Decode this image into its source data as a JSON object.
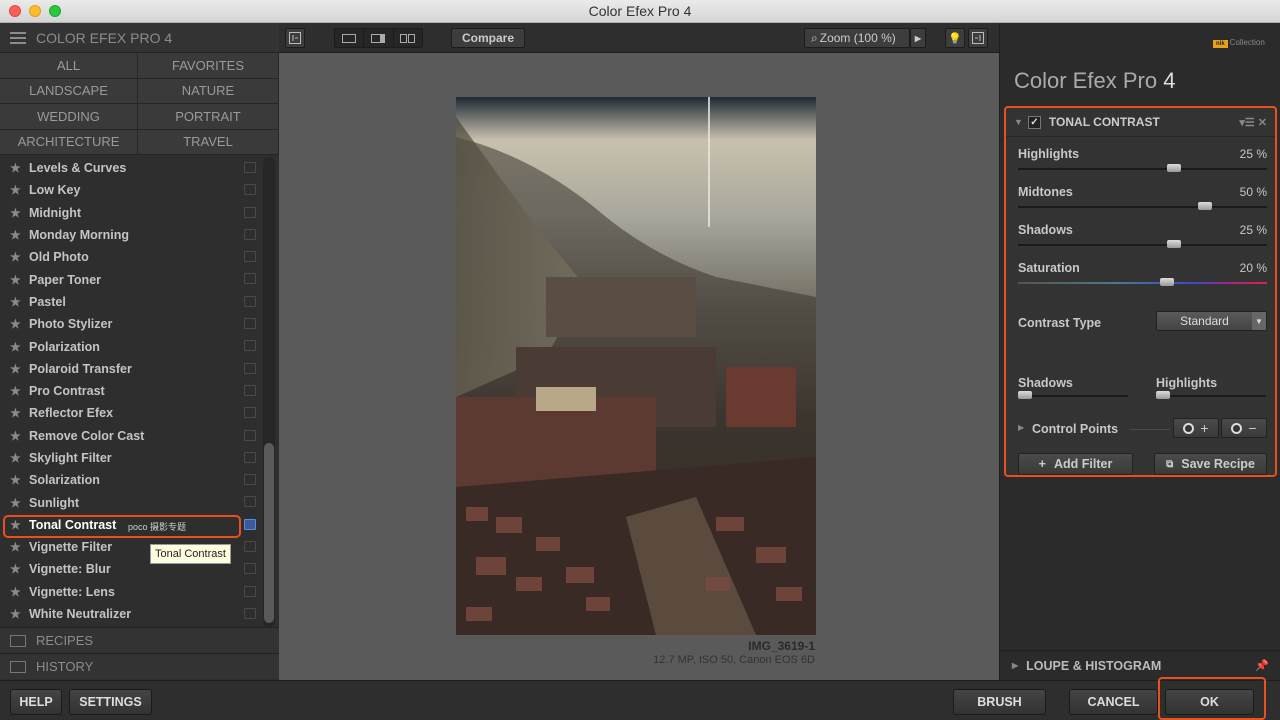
{
  "window": {
    "title": "Color Efex Pro 4"
  },
  "left_panel": {
    "header": "COLOR EFEX PRO 4",
    "categories": [
      "ALL",
      "FAVORITES",
      "LANDSCAPE",
      "NATURE",
      "WEDDING",
      "PORTRAIT",
      "ARCHITECTURE",
      "TRAVEL"
    ],
    "filters": [
      "Levels & Curves",
      "Low Key",
      "Midnight",
      "Monday Morning",
      "Old Photo",
      "Paper Toner",
      "Pastel",
      "Photo Stylizer",
      "Polarization",
      "Polaroid Transfer",
      "Pro Contrast",
      "Reflector Efex",
      "Remove Color Cast",
      "Skylight Filter",
      "Solarization",
      "Sunlight",
      "Tonal Contrast",
      "Vignette Filter",
      "Vignette: Blur",
      "Vignette: Lens",
      "White Neutralizer"
    ],
    "selected_filter": "Tonal Contrast",
    "watermark": "poco 摄影专题",
    "tooltip": "Tonal Contrast",
    "recipes": "RECIPES",
    "history": "HISTORY"
  },
  "toolbar": {
    "compare": "Compare",
    "zoom": "Zoom (100 %)"
  },
  "image": {
    "name": "IMG_3619-1",
    "info": "12.7 MP, ISO 50, Canon EOS 6D"
  },
  "right_panel": {
    "logo_badge": "nik",
    "logo_text": "Collection",
    "product_name": "Color Efex Pro",
    "product_version": "4",
    "filter": {
      "title": "TONAL CONTRAST",
      "enabled": true,
      "sliders": [
        {
          "label": "Highlights",
          "value_text": "25 %",
          "value": 25
        },
        {
          "label": "Midtones",
          "value_text": "50 %",
          "value": 50
        },
        {
          "label": "Shadows",
          "value_text": "25 %",
          "value": 25
        },
        {
          "label": "Saturation",
          "value_text": "20 %",
          "value": 20
        }
      ],
      "contrast_type_label": "Contrast Type",
      "contrast_type_value": "Standard",
      "shadows_label": "Shadows",
      "highlights_label": "Highlights",
      "control_points_label": "Control Points",
      "add_filter": "Add Filter",
      "save_recipe": "Save Recipe"
    },
    "loupe": "LOUPE & HISTOGRAM"
  },
  "bottom_bar": {
    "help": "HELP",
    "settings": "SETTINGS",
    "brush": "BRUSH",
    "cancel": "CANCEL",
    "ok": "OK"
  },
  "colors": {
    "highlight_border": "#e8501e"
  }
}
